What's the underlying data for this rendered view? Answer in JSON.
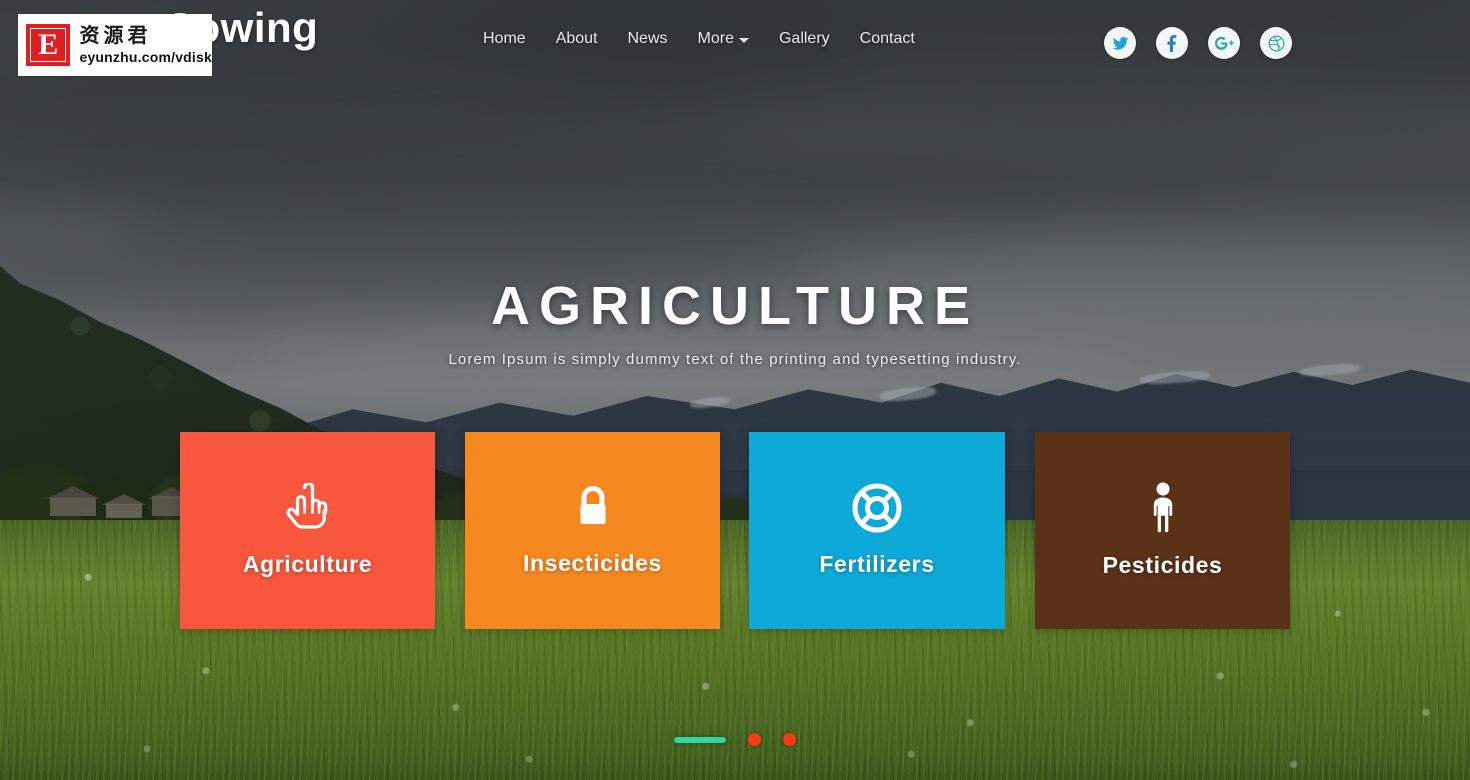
{
  "brand": {
    "name": "Sowing"
  },
  "nav": {
    "items": [
      {
        "label": "Home",
        "name": "nav-home"
      },
      {
        "label": "About",
        "name": "nav-about"
      },
      {
        "label": "News",
        "name": "nav-news"
      },
      {
        "label": "More",
        "name": "nav-more",
        "has_caret": true
      },
      {
        "label": "Gallery",
        "name": "nav-gallery"
      },
      {
        "label": "Contact",
        "name": "nav-contact"
      }
    ]
  },
  "socials": [
    {
      "icon": "twitter-icon",
      "label": "Twitter",
      "color": "#22a3dd"
    },
    {
      "icon": "facebook-icon",
      "label": "Facebook",
      "color": "#2a7ec4"
    },
    {
      "icon": "google-plus-icon",
      "label": "Google Plus",
      "color": "#2aa9a0"
    },
    {
      "icon": "dribbble-icon",
      "label": "Dribbble",
      "color": "#2aa9a0"
    }
  ],
  "hero": {
    "title": "AGRICULTURE",
    "subtitle": "Lorem Ipsum is simply dummy text of the printing and typesetting industry."
  },
  "cards": [
    {
      "title": "Agriculture",
      "icon": "hand-pointer-up-icon",
      "color": "#f9573d"
    },
    {
      "title": "Insecticides",
      "icon": "lock-icon",
      "color": "#f68820"
    },
    {
      "title": "Fertilizers",
      "icon": "life-ring-icon",
      "color": "#0da9d8"
    },
    {
      "title": "Pesticides",
      "icon": "person-icon",
      "color": "#5a3218"
    }
  ],
  "carousel": {
    "indicators": [
      {
        "type": "bar",
        "state": "active",
        "color": "#2fd6a3"
      },
      {
        "type": "dot",
        "state": "inactive",
        "color": "#f93b16"
      },
      {
        "type": "dot",
        "state": "inactive",
        "color": "#f93b16"
      }
    ]
  },
  "watermark": {
    "badge_letter": "E",
    "chinese": "资源君",
    "url": "eyunzhu.com/vdisk"
  }
}
